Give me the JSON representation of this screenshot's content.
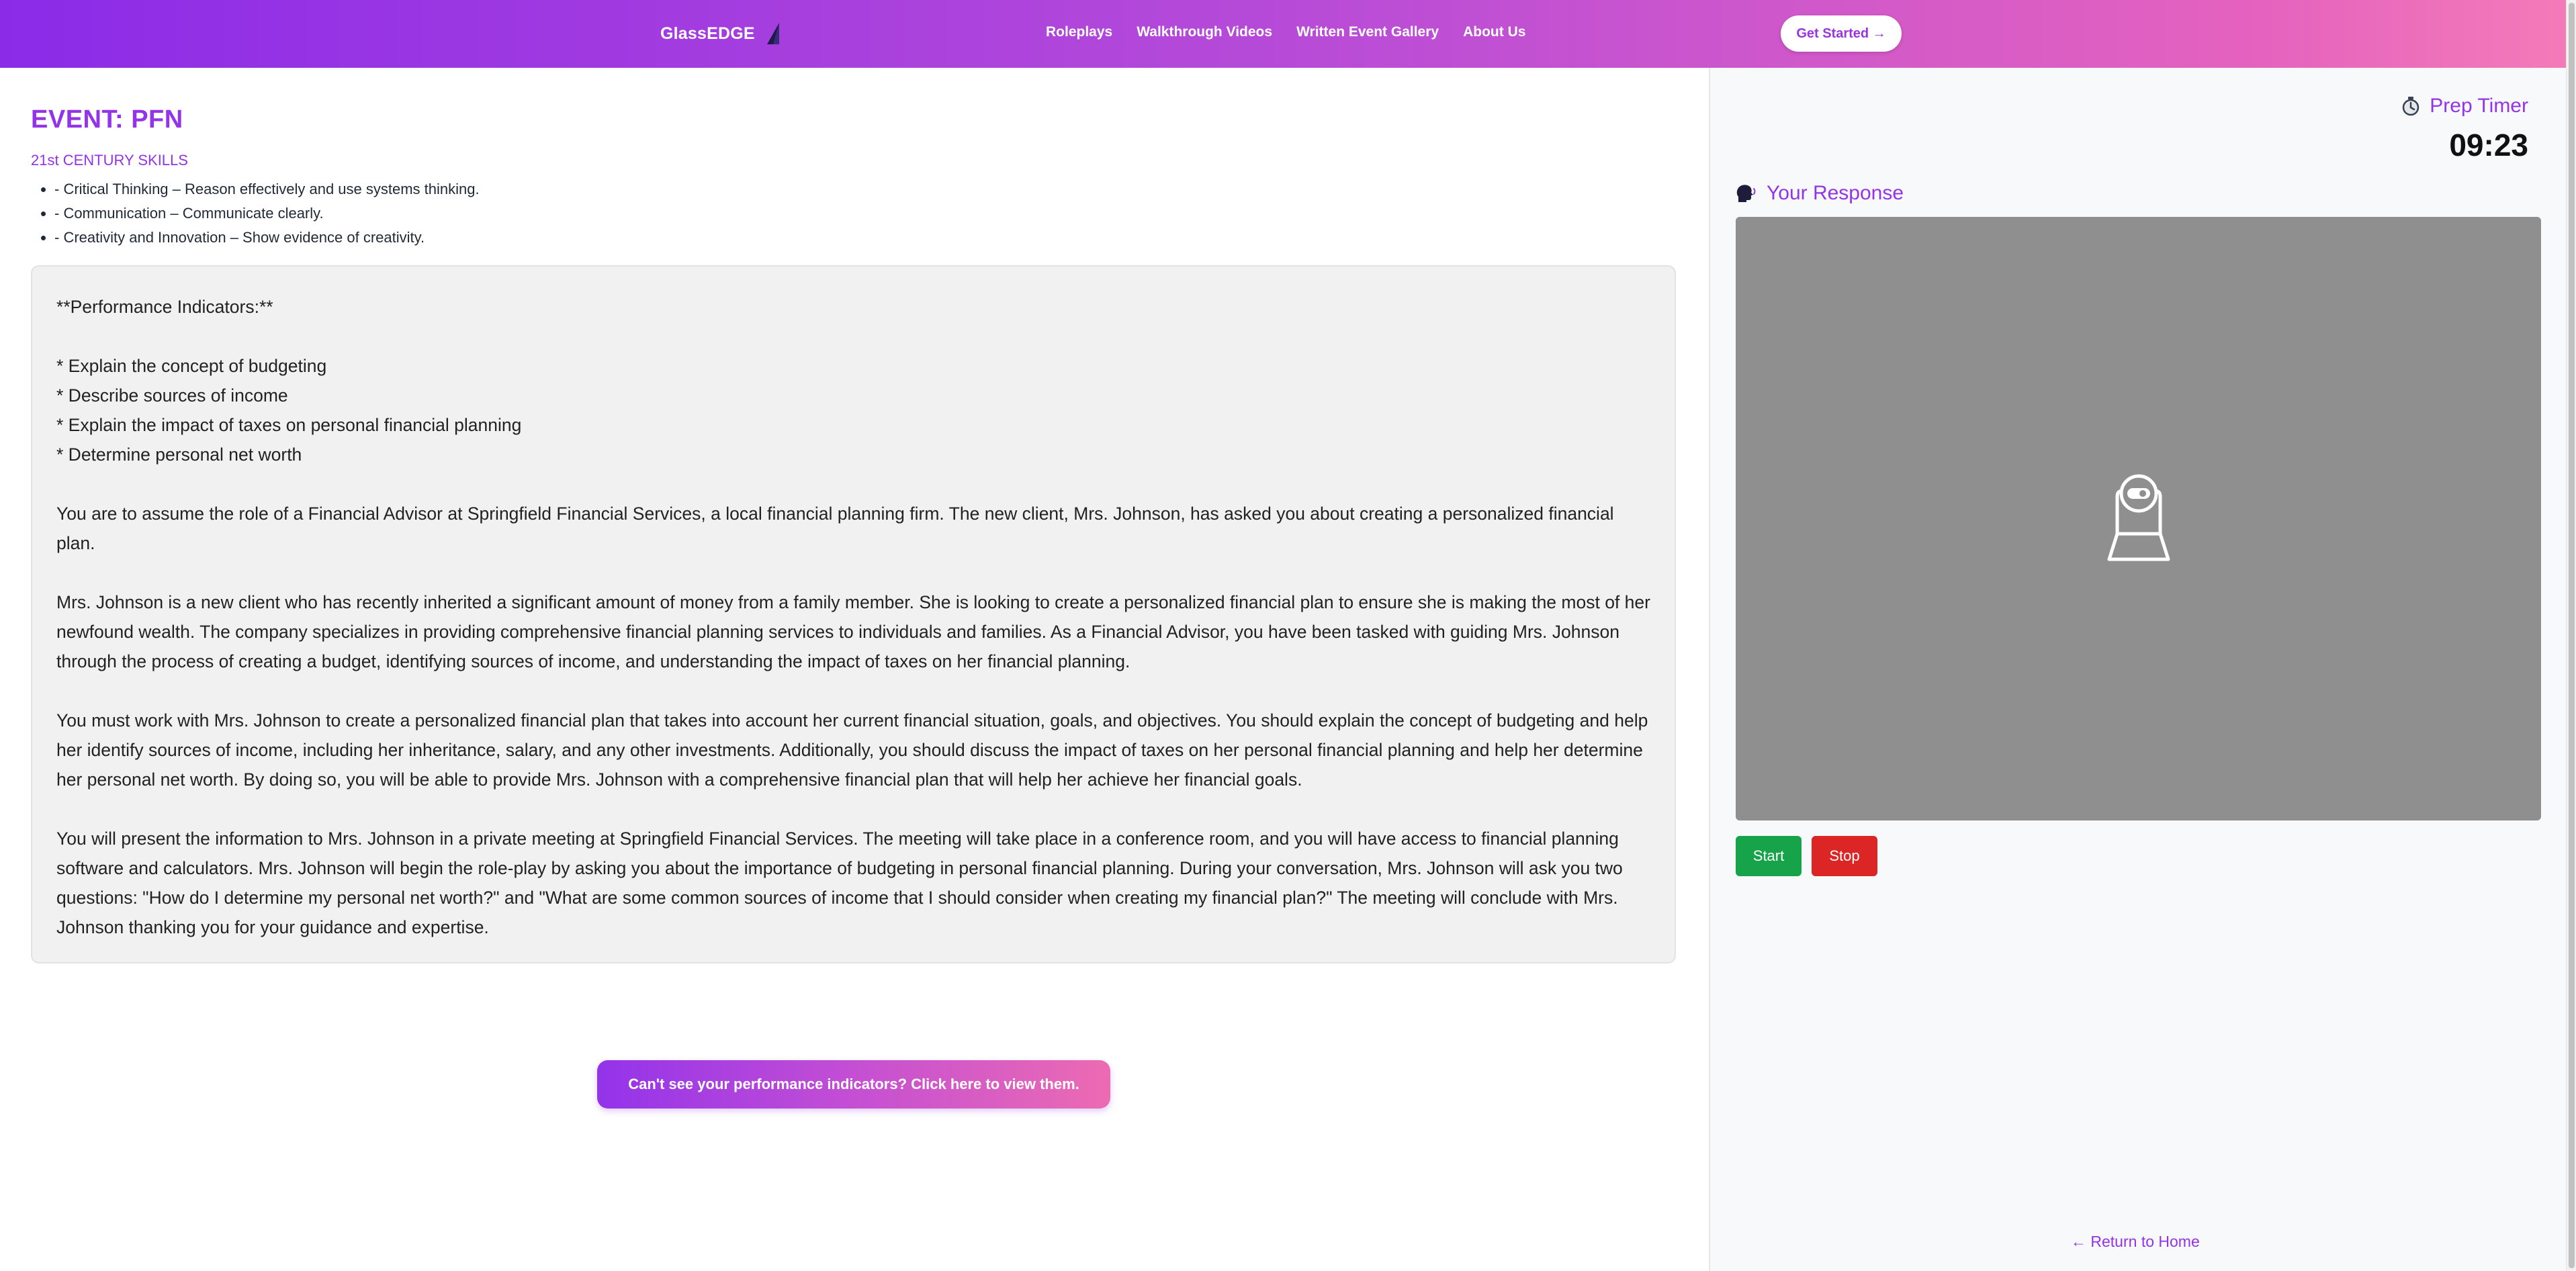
{
  "nav": {
    "brand": "GlassEDGE",
    "links": [
      "Roleplays",
      "Walkthrough Videos",
      "Written Event Gallery",
      "About Us"
    ],
    "cta": "Get Started →"
  },
  "event": {
    "title": "EVENT: PFN",
    "skills_heading": "21st CENTURY SKILLS",
    "skills": [
      "- Critical Thinking – Reason effectively and use systems thinking.",
      "- Communication – Communicate clearly.",
      "- Creativity and Innovation – Show evidence of creativity."
    ],
    "card": {
      "pi_header": "**Performance Indicators:**",
      "pi_items": [
        "* Explain the concept of budgeting",
        "* Describe sources of income",
        "* Explain the impact of taxes on personal financial planning",
        "* Determine personal net worth"
      ],
      "paragraphs": [
        "You are to assume the role of a Financial Advisor at Springfield Financial Services, a local financial planning firm. The new client, Mrs. Johnson, has asked you about creating a personalized financial plan.",
        "Mrs. Johnson is a new client who has recently inherited a significant amount of money from a family member. She is looking to create a personalized financial plan to ensure she is making the most of her newfound wealth. The company specializes in providing comprehensive financial planning services to individuals and families. As a Financial Advisor, you have been tasked with guiding Mrs. Johnson through the process of creating a budget, identifying sources of income, and understanding the impact of taxes on her financial planning.",
        "You must work with Mrs. Johnson to create a personalized financial plan that takes into account her current financial situation, goals, and objectives. You should explain the concept of budgeting and help her identify sources of income, including her inheritance, salary, and any other investments. Additionally, you should discuss the impact of taxes on her personal financial planning and help her determine her personal net worth. By doing so, you will be able to provide Mrs. Johnson with a comprehensive financial plan that will help her achieve her financial goals.",
        "You will present the information to Mrs. Johnson in a private meeting at Springfield Financial Services. The meeting will take place in a conference room, and you will have access to financial planning software and calculators. Mrs. Johnson will begin the role-play by asking you about the importance of budgeting in personal financial planning. During your conversation, Mrs. Johnson will ask you two questions: \"How do I determine my personal net worth?\" and \"What are some common sources of income that I should consider when creating my financial plan?\" The meeting will conclude with Mrs. Johnson thanking you for your guidance and expertise."
      ]
    },
    "pi_button": "Can't see your performance indicators? Click here to view them."
  },
  "side": {
    "timer_label": "Prep Timer",
    "timer_value": "09:23",
    "response_label": "Your Response",
    "start": "Start",
    "stop": "Stop",
    "return_home": "← Return to Home"
  },
  "colors": {
    "accent": "#9333ea",
    "start": "#16a34a",
    "stop": "#dc2626",
    "video_bg": "#8f8f8f"
  },
  "icons": {
    "brand": "sail-logo-icon",
    "timer": "stopwatch-icon",
    "response": "speaking-head-icon",
    "video": "webcam-icon"
  }
}
